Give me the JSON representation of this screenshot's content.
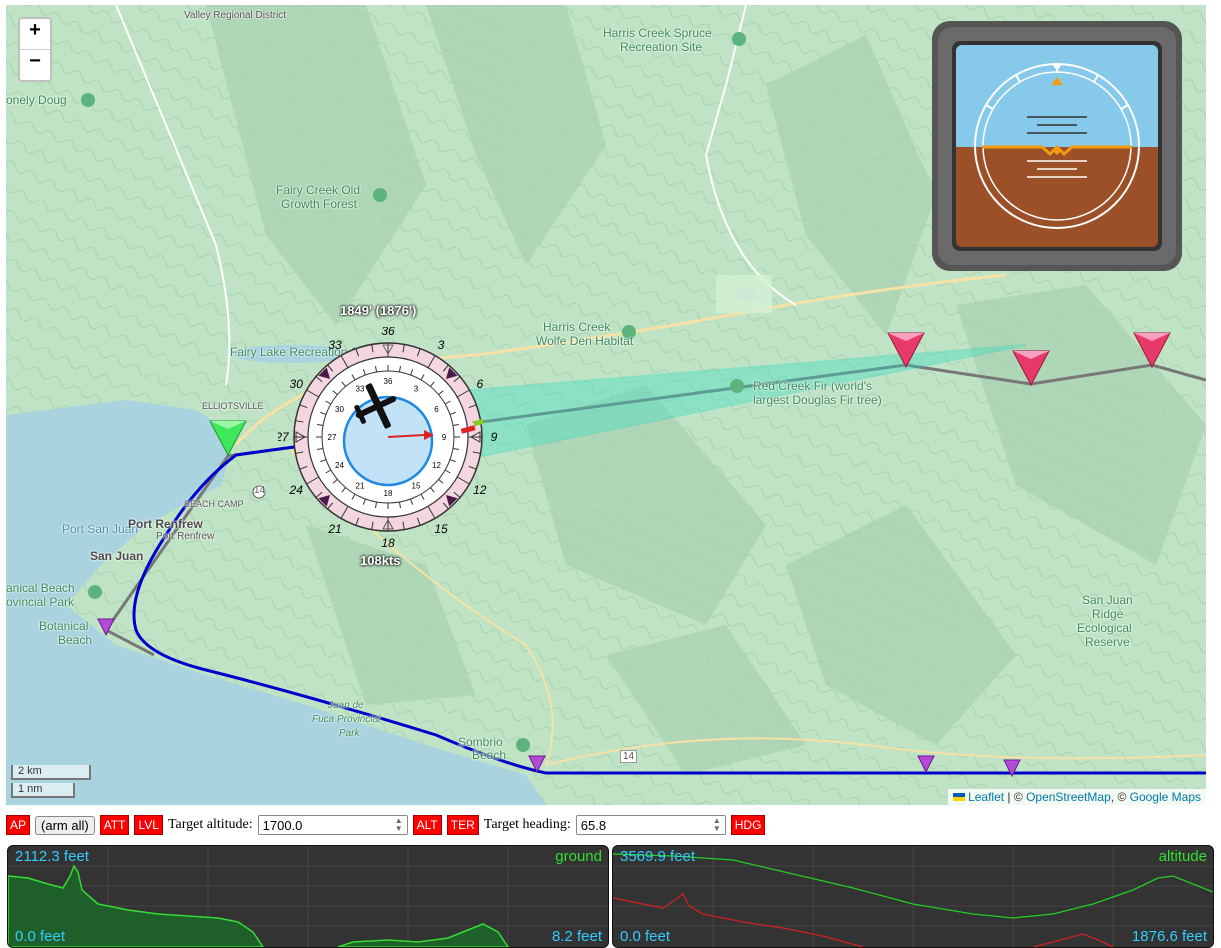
{
  "map": {
    "zoom_in": "+",
    "zoom_out": "−",
    "scale_km": "2 km",
    "scale_nm": "1 nm",
    "attribution": {
      "leaflet": "Leaflet",
      "sep1": " | © ",
      "osm": "OpenStreetMap",
      "sep2": ", © ",
      "google": "Google Maps"
    },
    "places": {
      "harris_spruce_1": "Harris Creek Spruce",
      "harris_spruce_2": "Recreation Site",
      "lonely_doug": "onely Doug",
      "fairy_creek_1": "Fairy Creek Old",
      "fairy_creek_2": "Growth Forest",
      "fairy_lake": "Fairy Lake Recreation Site",
      "harris_wolfe_1": "Harris Creek",
      "harris_wolfe_2": "Wolfe Den Habitat",
      "red_creek_1": "Red Creek Fir (world's",
      "red_creek_2": "largest Douglas Fir tree)",
      "ellIotsville": "ELLIOTSVILLE",
      "port_san_juan": "Port San Juan",
      "port_renfrew": "Port Renfrew",
      "port_renfrew_2": "Port Renfrew",
      "beach_camp": "BEACH CAMP",
      "san_juan": "San Juan",
      "botanical_1": "anical Beach",
      "botanical_2": "ovincial Park",
      "botanical_3": "Botanical",
      "botanical_4": "Beach",
      "juan_fuca_1": "Juan de",
      "juan_fuca_2": "Fuca Provincial",
      "juan_fuca_3": "Park",
      "sombrio_1": "Sombrio",
      "sombrio_2": "Beach",
      "san_juan_ridge_1": "San Juan",
      "san_juan_ridge_2": "Ridge",
      "san_juan_ridge_3": "Ecological",
      "san_juan_ridge_4": "Reserve",
      "district": "Valley Regional District",
      "road_14": "14",
      "road_14b": "14"
    },
    "plane": {
      "altitude_label": "1849' (1876')",
      "speed_label": "108kts",
      "compass_outer": [
        "36",
        "3",
        "6",
        "9",
        "12",
        "15",
        "18",
        "21",
        "24",
        "27",
        "30",
        "33"
      ],
      "compass_inner": [
        "36",
        "3",
        "6",
        "9",
        "12",
        "15",
        "18",
        "21",
        "24",
        "27",
        "30",
        "33"
      ]
    }
  },
  "attitude_indicator": {
    "pitch_deg": 0,
    "roll_deg": 0
  },
  "controls": {
    "ap": "AP",
    "arm_all": "(arm all)",
    "att": "ATT",
    "lvl": "LVL",
    "target_altitude_label": "Target altitude:",
    "target_altitude_value": "1700.0",
    "alt": "ALT",
    "ter": "TER",
    "target_heading_label": "Target heading:",
    "target_heading_value": "65.8",
    "hdg": "HDG"
  },
  "graphs": {
    "ground": {
      "max": "2112.3 feet",
      "min": "0.0 feet",
      "label": "ground",
      "current": "8.2 feet"
    },
    "altitude": {
      "max": "3569.9 feet",
      "min": "0.0 feet",
      "label": "altitude",
      "current": "1876.6 feet"
    }
  },
  "colors": {
    "map_bg": "#bfe3c4",
    "water": "#a9d3df",
    "route": "#0000cc",
    "cone": "#2fe0c8",
    "active_btn": "#ff0000",
    "graph_cyan": "#33ccff",
    "graph_green": "#33dd33"
  }
}
